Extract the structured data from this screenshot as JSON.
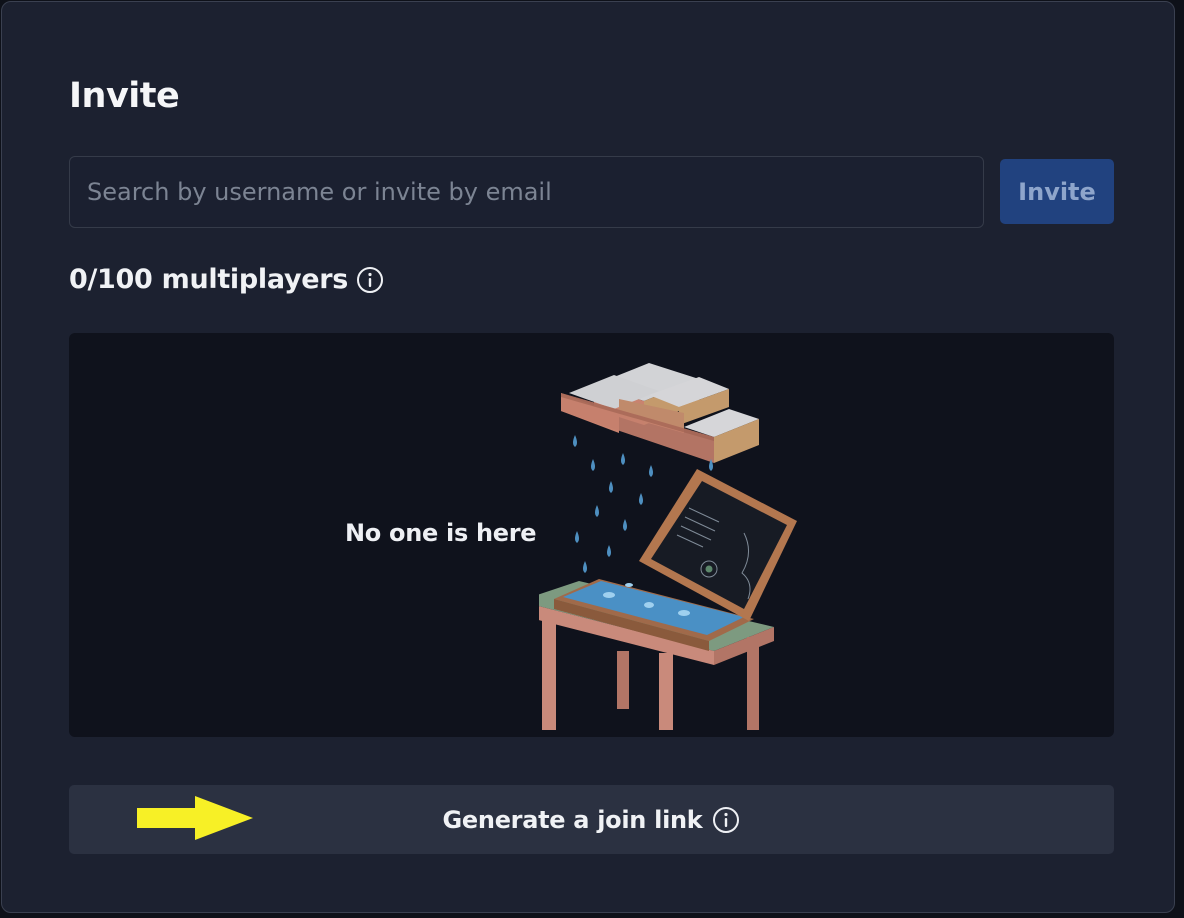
{
  "invite": {
    "title": "Invite",
    "search_placeholder": "Search by username or invite by email",
    "search_value": "",
    "invite_button_label": "Invite"
  },
  "multiplayers": {
    "count_label": "0/100 multiplayers",
    "info_icon": "info-circle-icon"
  },
  "empty_state": {
    "message": "No one is here",
    "illustration": "rain-cloud-laptop-illustration"
  },
  "join_link": {
    "label": "Generate a join link",
    "info_icon": "info-circle-icon"
  },
  "annotation": {
    "arrow": "yellow-arrow-right"
  },
  "colors": {
    "panel_bg": "#1c2130",
    "invite_button_bg": "#21427f",
    "empty_box_bg": "#0f121c",
    "join_button_bg": "#2b3141",
    "arrow": "#f7f026"
  }
}
